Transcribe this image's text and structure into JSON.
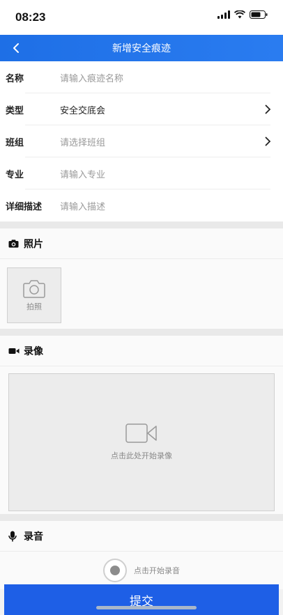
{
  "status_bar": {
    "time": "08:23"
  },
  "navbar": {
    "title": "新增安全痕迹"
  },
  "form": {
    "rows": [
      {
        "label": "名称",
        "value": "请输入痕迹名称",
        "filled": false,
        "chevron": false
      },
      {
        "label": "类型",
        "value": "安全交底会",
        "filled": true,
        "chevron": true
      },
      {
        "label": "班组",
        "value": "请选择班组",
        "filled": false,
        "chevron": true
      },
      {
        "label": "专业",
        "value": "请输入专业",
        "filled": false,
        "chevron": false
      },
      {
        "label": "详细描述",
        "value": "请输入描述",
        "filled": false,
        "chevron": false
      }
    ]
  },
  "photo": {
    "title": "照片",
    "capture_label": "拍照",
    "icon": "camera-icon"
  },
  "video": {
    "title": "录像",
    "hint": "点击此处开始录像",
    "icon": "video-icon"
  },
  "audio": {
    "title": "录音",
    "hint": "点击开始录音",
    "icon": "microphone-icon"
  },
  "submit": {
    "label": "提交"
  },
  "colors": {
    "accent": "#1e6fe6",
    "placeholder": "#999999"
  }
}
